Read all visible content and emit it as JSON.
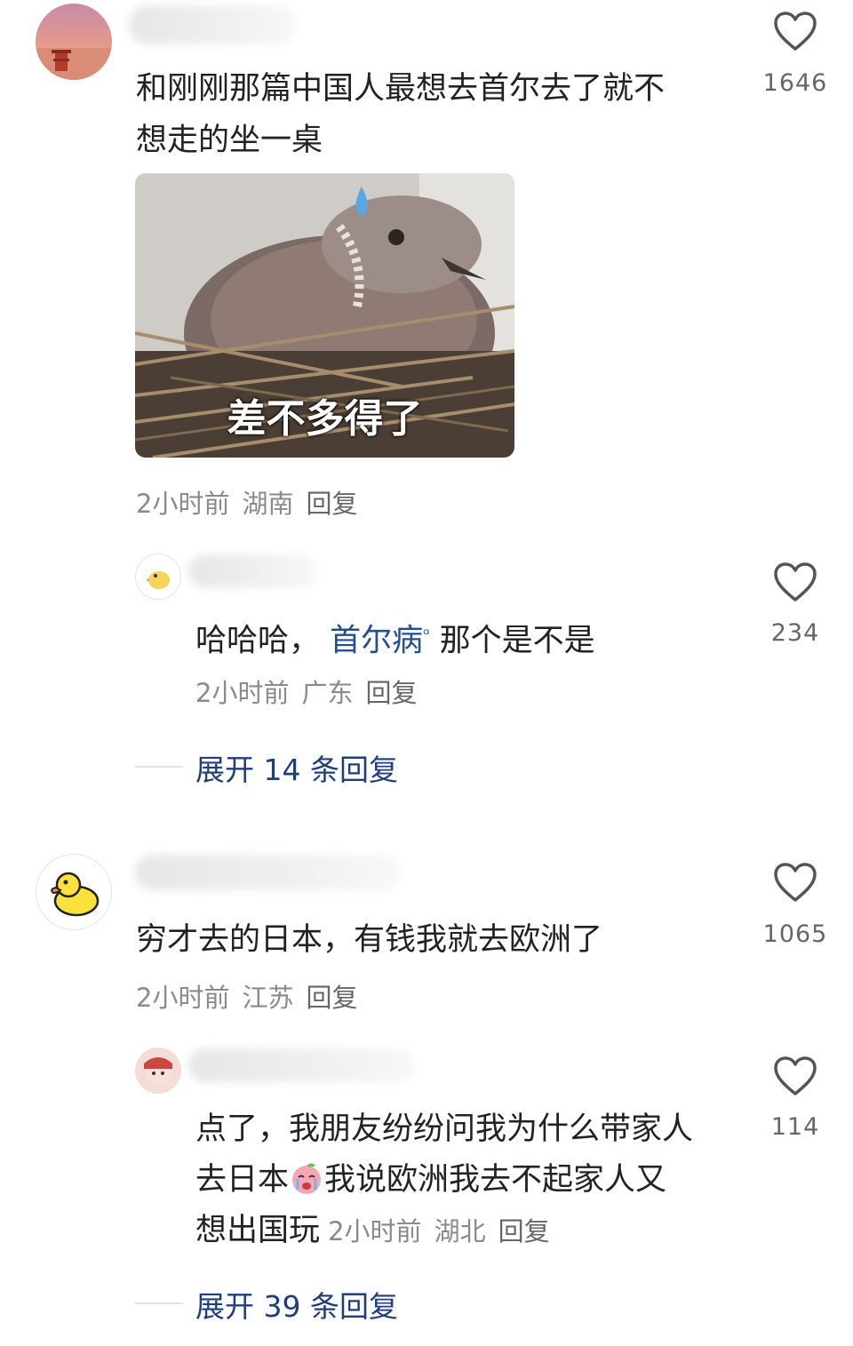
{
  "comments": [
    {
      "text_lines": [
        "和刚刚那篇中国人最想去首尔去了就不",
        "想走的坐一桌"
      ],
      "image_caption": "差不多得了",
      "time": "2小时前",
      "location": "湖南",
      "reply_label": "回复",
      "likes": "1646",
      "replies": [
        {
          "text_prefix": "哈哈哈，",
          "link_text": "首尔病",
          "text_suffix": "那个是不是",
          "time": "2小时前",
          "location": "广东",
          "reply_label": "回复",
          "likes": "234"
        }
      ],
      "expand_label": "展开 14 条回复"
    },
    {
      "text_lines": [
        "穷才去的日本，有钱我就去欧洲了"
      ],
      "time": "2小时前",
      "location": "江苏",
      "reply_label": "回复",
      "likes": "1065",
      "replies": [
        {
          "text_lines": [
            "点了，我朋友纷纷问我为什么带家人",
            "去日本",
            "我说欧洲我去不起家人又",
            "想出国玩"
          ],
          "time": "2小时前",
          "location": "湖北",
          "reply_label": "回复",
          "likes": "114"
        }
      ],
      "expand_label": "展开 39 条回复"
    }
  ],
  "icons": {
    "like": "heart-outline-icon",
    "emoji": "crying-peach-emoji-icon",
    "link_badge": "search-hint-icon"
  },
  "colors": {
    "link": "#244f8f",
    "meta": "#8a8a8a"
  }
}
